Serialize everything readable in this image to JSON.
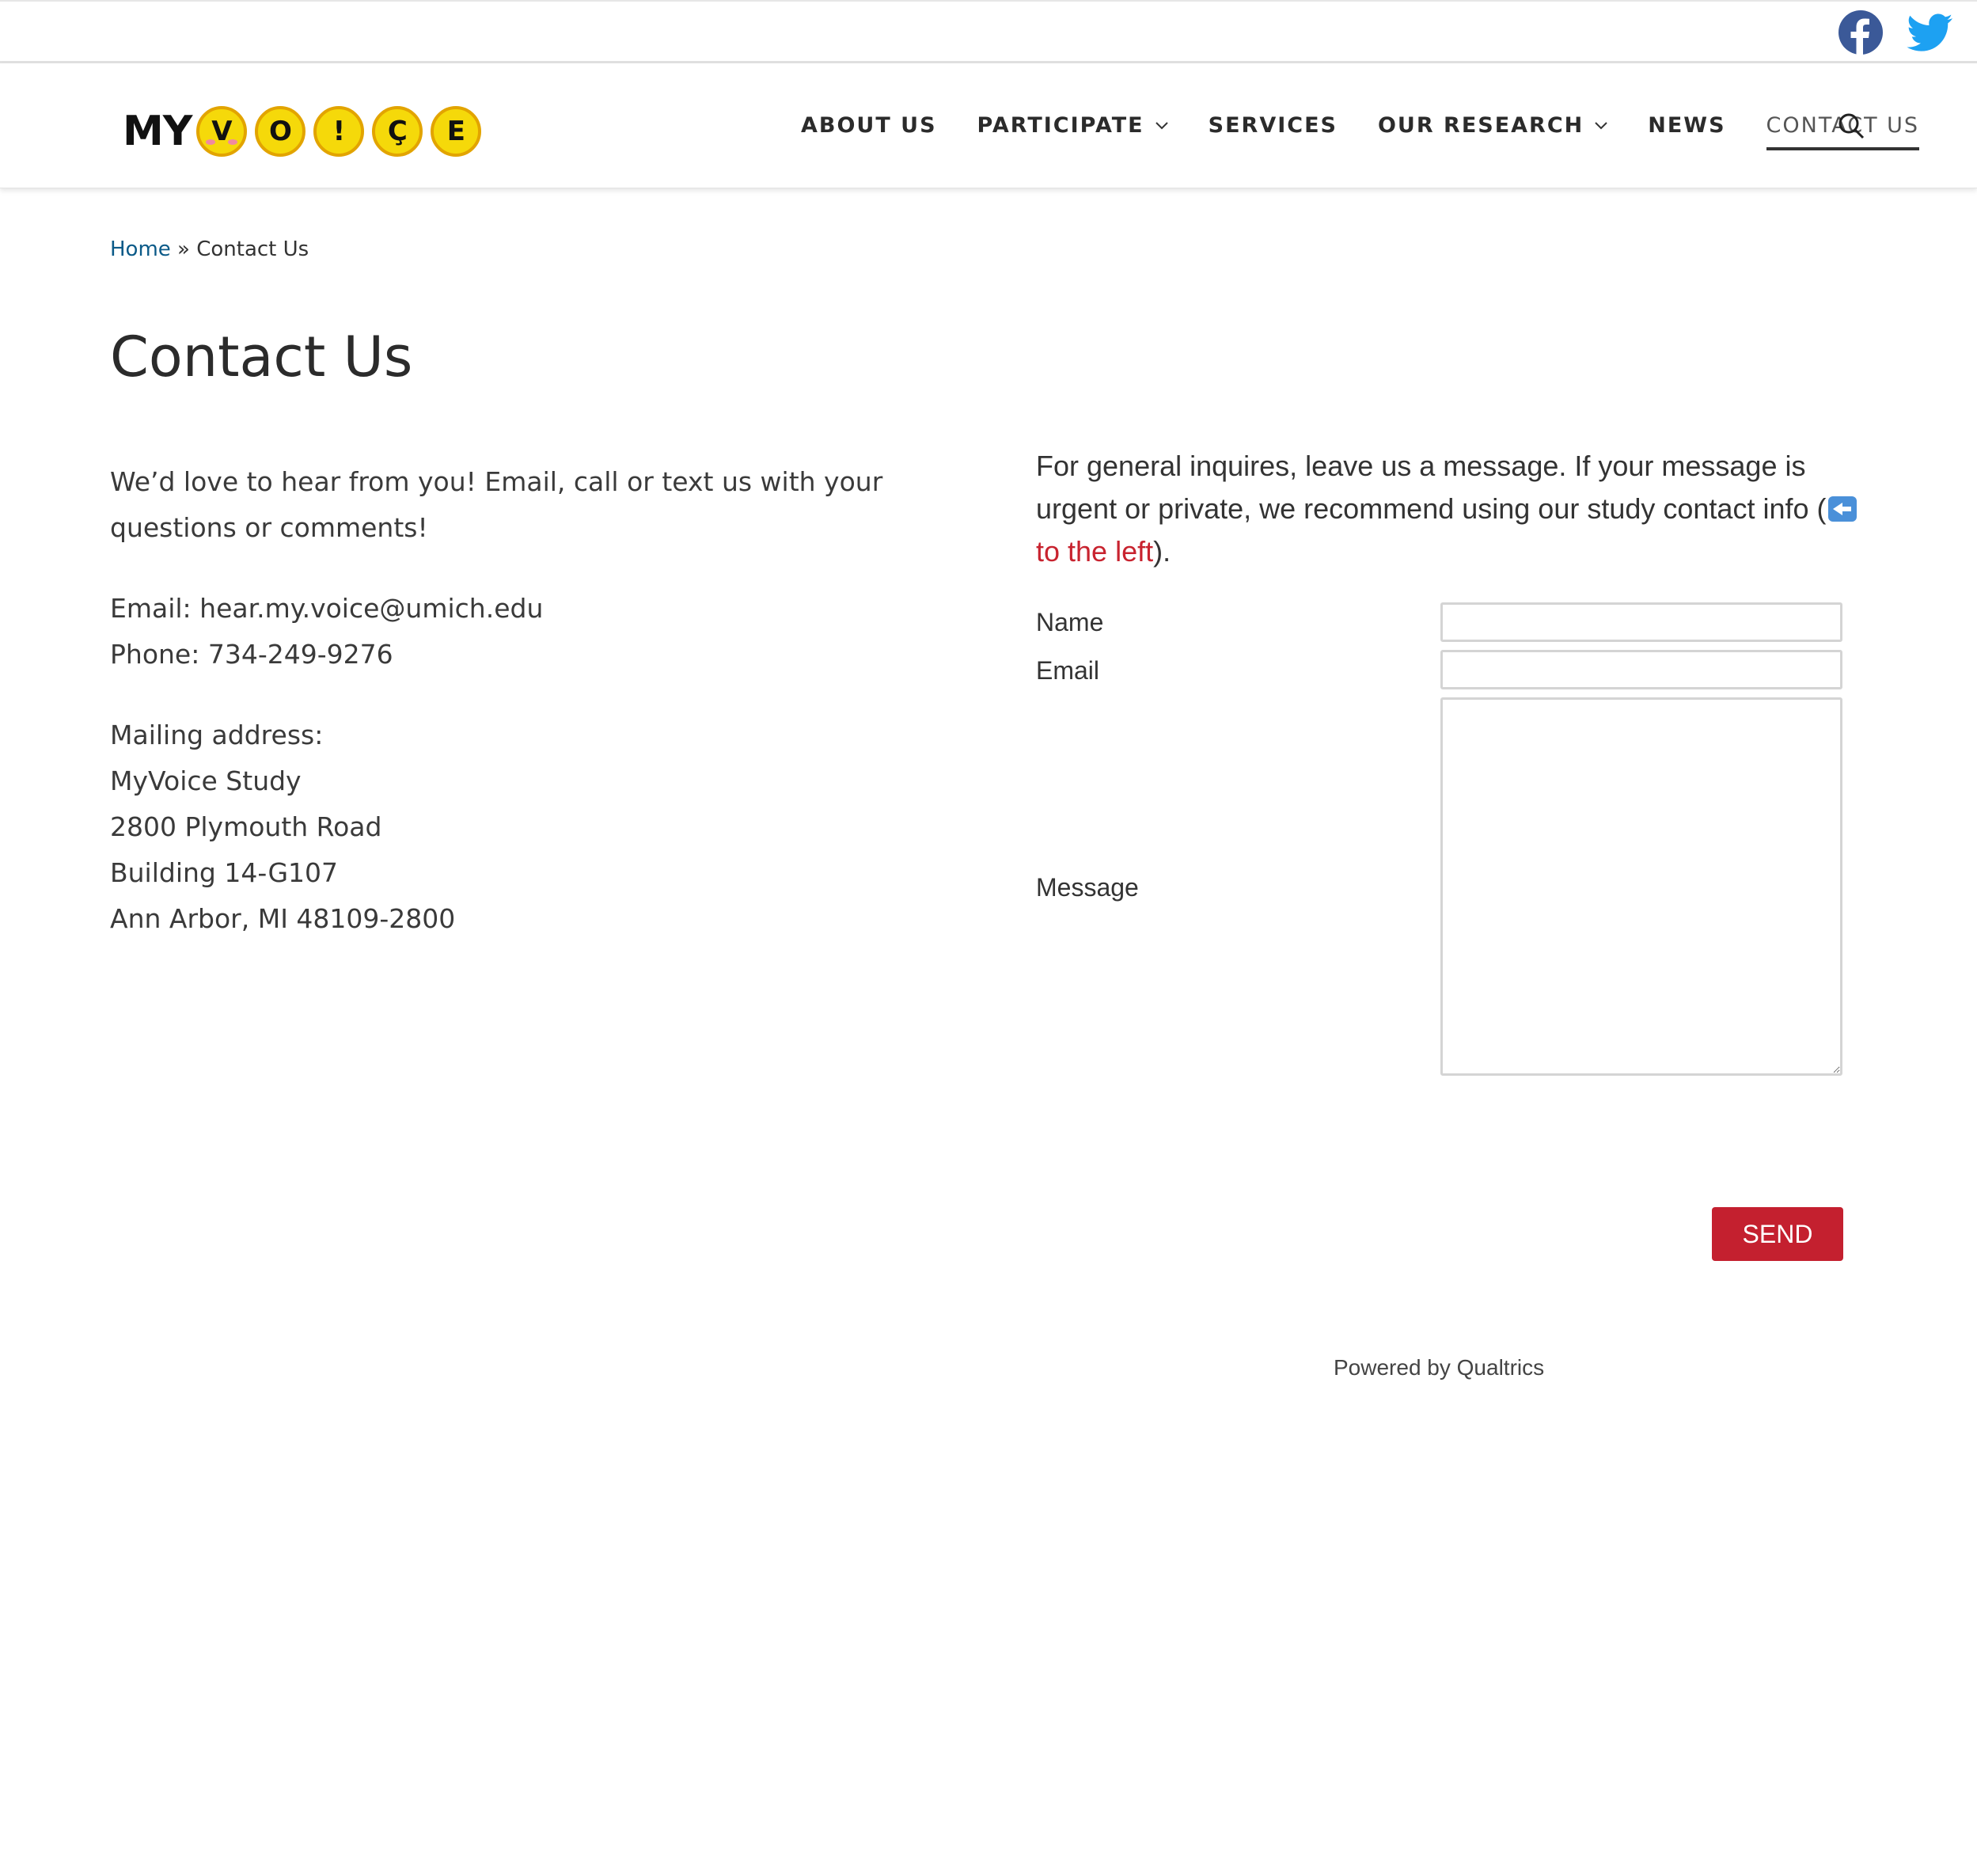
{
  "social": {
    "facebook_icon": "facebook-icon",
    "twitter_icon": "twitter-icon",
    "facebook_color": "#3b5998",
    "twitter_color": "#1da1f2"
  },
  "logo": {
    "text": "MY",
    "letters": [
      "V",
      "O",
      "!",
      "Ç",
      "E"
    ]
  },
  "nav": {
    "items": [
      {
        "label": "ABOUT US"
      },
      {
        "label": "PARTICIPATE"
      },
      {
        "label": "SERVICES"
      },
      {
        "label": "OUR RESEARCH"
      },
      {
        "label": "NEWS"
      },
      {
        "label": "CONTACT US"
      }
    ]
  },
  "breadcrumb": {
    "home": "Home",
    "separator": " » ",
    "current": "Contact Us"
  },
  "page": {
    "title": "Contact Us"
  },
  "contact": {
    "intro": "We’d love to hear from you! Email, call or text us with your questions or comments!",
    "email": "Email: hear.my.voice@umich.edu",
    "phone": "Phone: 734-249-9276",
    "mailing_heading": "Mailing address:",
    "address": [
      "MyVoice Study",
      "2800 Plymouth Road",
      "Building 14-G107",
      "Ann Arbor, MI 48109-2800"
    ]
  },
  "form": {
    "intro_text": "For general inquires, leave us a message. If your message is urgent or private, we recommend using our study contact info (",
    "intro_link": "to the left",
    "intro_end": ").",
    "name_label": "Name",
    "email_label": "Email",
    "message_label": "Message",
    "name_value": "",
    "email_value": "",
    "message_value": "",
    "send_label": "SEND",
    "powered_by": "Powered by Qualtrics"
  },
  "colors": {
    "accent": "#c4202f",
    "link": "#0b5a88",
    "logo_yellow": "#f5d90a"
  }
}
